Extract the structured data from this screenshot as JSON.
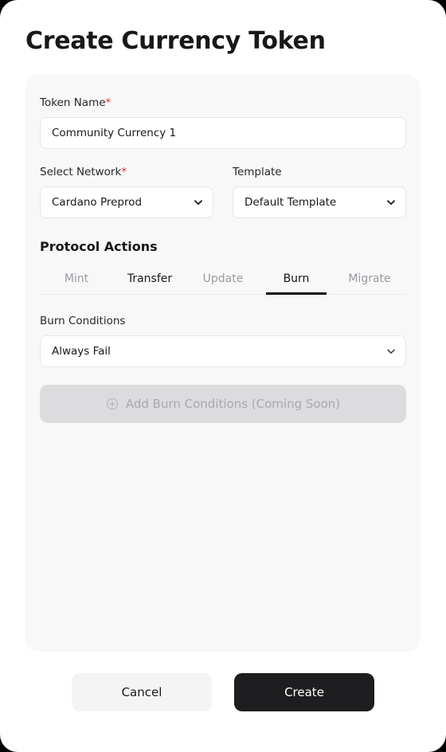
{
  "header": {
    "title": "Create Currency Token"
  },
  "form": {
    "token_name": {
      "label": "Token Name",
      "required_mark": "*",
      "value": "Community Currency 1",
      "placeholder": "Token Name"
    },
    "network": {
      "label": "Select Network",
      "required_mark": "*",
      "value": "Cardano Preprod",
      "icon": "chevron-down-icon"
    },
    "template": {
      "label": "Template",
      "value": "Default Template",
      "icon": "chevron-down-icon"
    }
  },
  "protocol_actions": {
    "title": "Protocol Actions",
    "tabs": [
      {
        "label": "Mint",
        "state": "inactive"
      },
      {
        "label": "Transfer",
        "state": "emphasis"
      },
      {
        "label": "Update",
        "state": "inactive"
      },
      {
        "label": "Burn",
        "state": "active"
      },
      {
        "label": "Migrate",
        "state": "inactive"
      }
    ]
  },
  "burn": {
    "conditions_label": "Burn Conditions",
    "conditions_value": "Always Fail",
    "conditions_icon": "chevron-down-icon",
    "add_button_label": "Add Burn Conditions (Coming Soon)",
    "add_button_icon": "circle-plus-icon",
    "add_button_disabled": true
  },
  "footer": {
    "cancel_label": "Cancel",
    "create_label": "Create"
  },
  "colors": {
    "accent_required": "#e03131",
    "primary_button": "#1e1e20",
    "card_background": "#f8f8f9",
    "active_tab_underline": "#0a0a0a"
  }
}
